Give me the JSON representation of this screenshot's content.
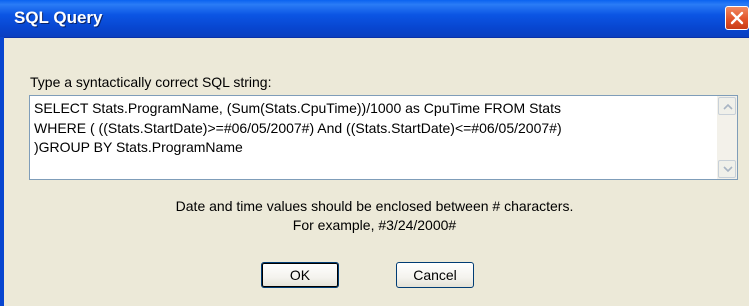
{
  "window": {
    "title": "SQL Query",
    "close_icon": "close-icon"
  },
  "prompt_label": "Type a syntactically correct SQL string:",
  "sql": {
    "line1": "SELECT Stats.ProgramName, (Sum(Stats.CpuTime))/1000 as CpuTime FROM Stats",
    "line2": "WHERE ( ((Stats.StartDate)>=#06/05/2007#) And ((Stats.StartDate)<=#06/05/2007#)",
    "line3": ")GROUP BY Stats.ProgramName"
  },
  "info": {
    "line1": "Date and time values should be enclosed between # characters.",
    "line2": "For example, #3/24/2000#"
  },
  "buttons": {
    "ok_label": "OK",
    "cancel_label": "Cancel"
  },
  "colors": {
    "titlebar": "#0846d0",
    "close": "#e2542a",
    "face": "#ece9d8"
  }
}
